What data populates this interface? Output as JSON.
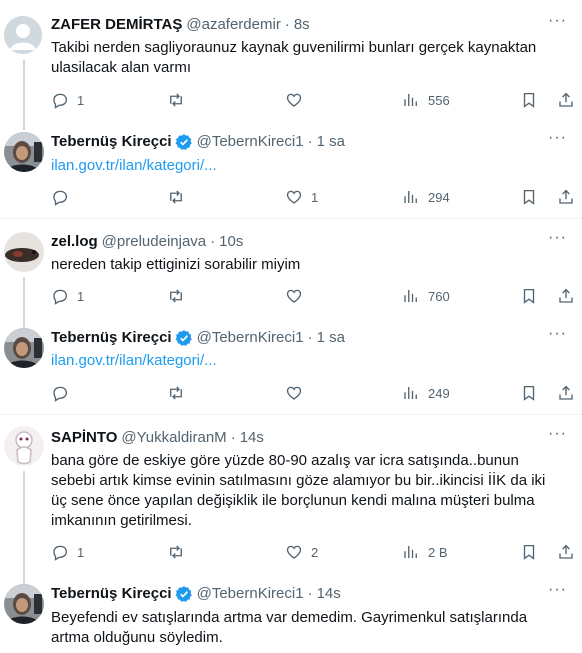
{
  "tweets": [
    {
      "name": "ZAFER DEMİRTAŞ",
      "handle": "@azaferdemir",
      "time": "8s",
      "text_lines": [
        "Takibi nerden sagliyoraunuz kaynak guvenilirmi bunları gerçek kaynaktan",
        "ulasilacak alan varmı"
      ],
      "replies": "1",
      "retweets": "",
      "likes": "",
      "views": "556",
      "verified": false,
      "avatar": "default-avatar"
    },
    {
      "name": "Tebernüş Kireçci",
      "handle": "@TebernKireci1",
      "time": "1 sa",
      "text_lines": [
        "ilan.gov.tr/ilan/kategori/..."
      ],
      "is_link": true,
      "replies": "",
      "retweets": "",
      "likes": "1",
      "views": "294",
      "verified": true,
      "avatar": "profile-photo"
    },
    {
      "name": "zel.log",
      "handle": "@preludeinjava",
      "time": "10s",
      "text_lines": [
        "nereden takip ettiginizi sorabilir miyim"
      ],
      "replies": "1",
      "retweets": "",
      "likes": "",
      "views": "760",
      "verified": false,
      "avatar": "profile-photo"
    },
    {
      "name": "Tebernüş Kireçci",
      "handle": "@TebernKireci1",
      "time": "1 sa",
      "text_lines": [
        "ilan.gov.tr/ilan/kategori/..."
      ],
      "is_link": true,
      "replies": "",
      "retweets": "",
      "likes": "",
      "views": "249",
      "verified": true,
      "avatar": "profile-photo"
    },
    {
      "name": "SAPİNTO",
      "handle": "@YukkaldiranM",
      "time": "14s",
      "text_lines": [
        "bana göre de eskiye göre yüzde 80-90 azalış var icra satışında..bunun",
        "sebebi artık kimse evinin satılmasını göze alamıyor bu bir..ikincisi İİK da iki",
        "üç sene önce yapılan değişiklik ile borçlunun kendi malına müşteri bulma",
        "imkanının getirilmesi."
      ],
      "replies": "1",
      "retweets": "",
      "likes": "2",
      "views": "2 B",
      "verified": false,
      "avatar": "profile-photo"
    },
    {
      "name": "Tebernüş Kireçci",
      "handle": "@TebernKireci1",
      "time": "14s",
      "text_lines": [
        "Beyefendi ev satışlarında artma var demedim. Gayrimenkul satışlarında",
        "artma olduğunu söyledim."
      ],
      "verified": true,
      "avatar": "profile-photo"
    }
  ],
  "colors": {
    "text": "#0f1419",
    "secondary": "#536471",
    "link": "#1d9bf0",
    "verified": "#1d9bf0",
    "divider": "#eff3f4"
  }
}
